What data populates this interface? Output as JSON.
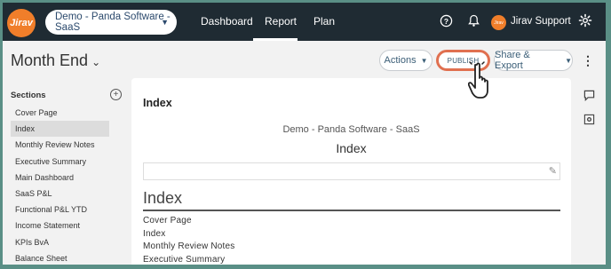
{
  "app": {
    "logo_text": "Jirav"
  },
  "header": {
    "company_selector": "Demo - Panda Software - SaaS",
    "nav": [
      "Dashboard",
      "Report",
      "Plan"
    ],
    "active_nav": "Report",
    "user_name": "Jirav Support",
    "avatar_text": "Jirav"
  },
  "toolbar": {
    "page_title": "Month End",
    "actions_label": "Actions",
    "publish_label": "PUBLISH",
    "share_export_label": "Share & Export"
  },
  "sidebar": {
    "title": "Sections",
    "items": [
      {
        "label": "Cover Page",
        "active": false
      },
      {
        "label": "Index",
        "active": true
      },
      {
        "label": "Monthly Review Notes",
        "active": false
      },
      {
        "label": "Executive Summary",
        "active": false
      },
      {
        "label": "Main Dashboard",
        "active": false
      },
      {
        "label": "SaaS P&L",
        "active": false
      },
      {
        "label": "Functional P&L YTD",
        "active": false
      },
      {
        "label": "Income Statement",
        "active": false
      },
      {
        "label": "KPIs BvA",
        "active": false
      },
      {
        "label": "Balance Sheet",
        "active": false
      }
    ]
  },
  "content": {
    "section_title": "Index",
    "company_name": "Demo - Panda Software - SaaS",
    "subtitle": "Index",
    "index_heading": "Index",
    "index_items": [
      "Cover Page",
      "Index",
      "Monthly Review Notes",
      "Executive Summary"
    ]
  },
  "colors": {
    "topbar": "#1f2b33",
    "accent": "#f07e2a",
    "publish_highlight": "#e07050"
  }
}
